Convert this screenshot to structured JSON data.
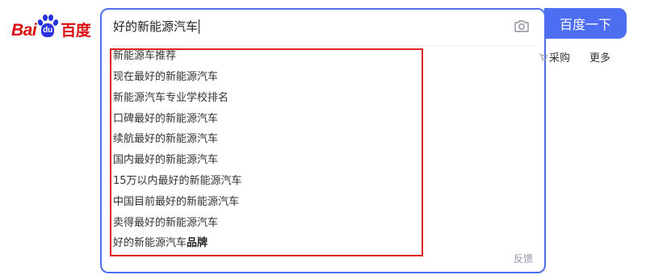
{
  "logo": {
    "part1": "Bai",
    "paw_text": "du",
    "part2": "百度"
  },
  "search": {
    "query": "好的新能源汽车",
    "button_label": "百度一下"
  },
  "suggestions": [
    {
      "text": "新能源车推荐"
    },
    {
      "text": "现在最好的新能源汽车"
    },
    {
      "text": "新能源汽车专业学校排名"
    },
    {
      "text": "口碑最好的新能源汽车"
    },
    {
      "text": "续航最好的新能源汽车"
    },
    {
      "text": "国内最好的新能源汽车"
    },
    {
      "text": "15万以内最好的新能源汽车"
    },
    {
      "text": "中国目前最好的新能源汽车"
    },
    {
      "text": "卖得最好的新能源汽车"
    },
    {
      "text": "好的新能源汽车",
      "suffix": "品牌"
    }
  ],
  "feedback_label": "反馈",
  "nav": {
    "caigou": "采购",
    "more": "更多"
  },
  "colors": {
    "accent": "#4e6ef2",
    "highlight_border": "#e02020",
    "logo_red": "#de0a10",
    "logo_blue": "#2932e1"
  }
}
